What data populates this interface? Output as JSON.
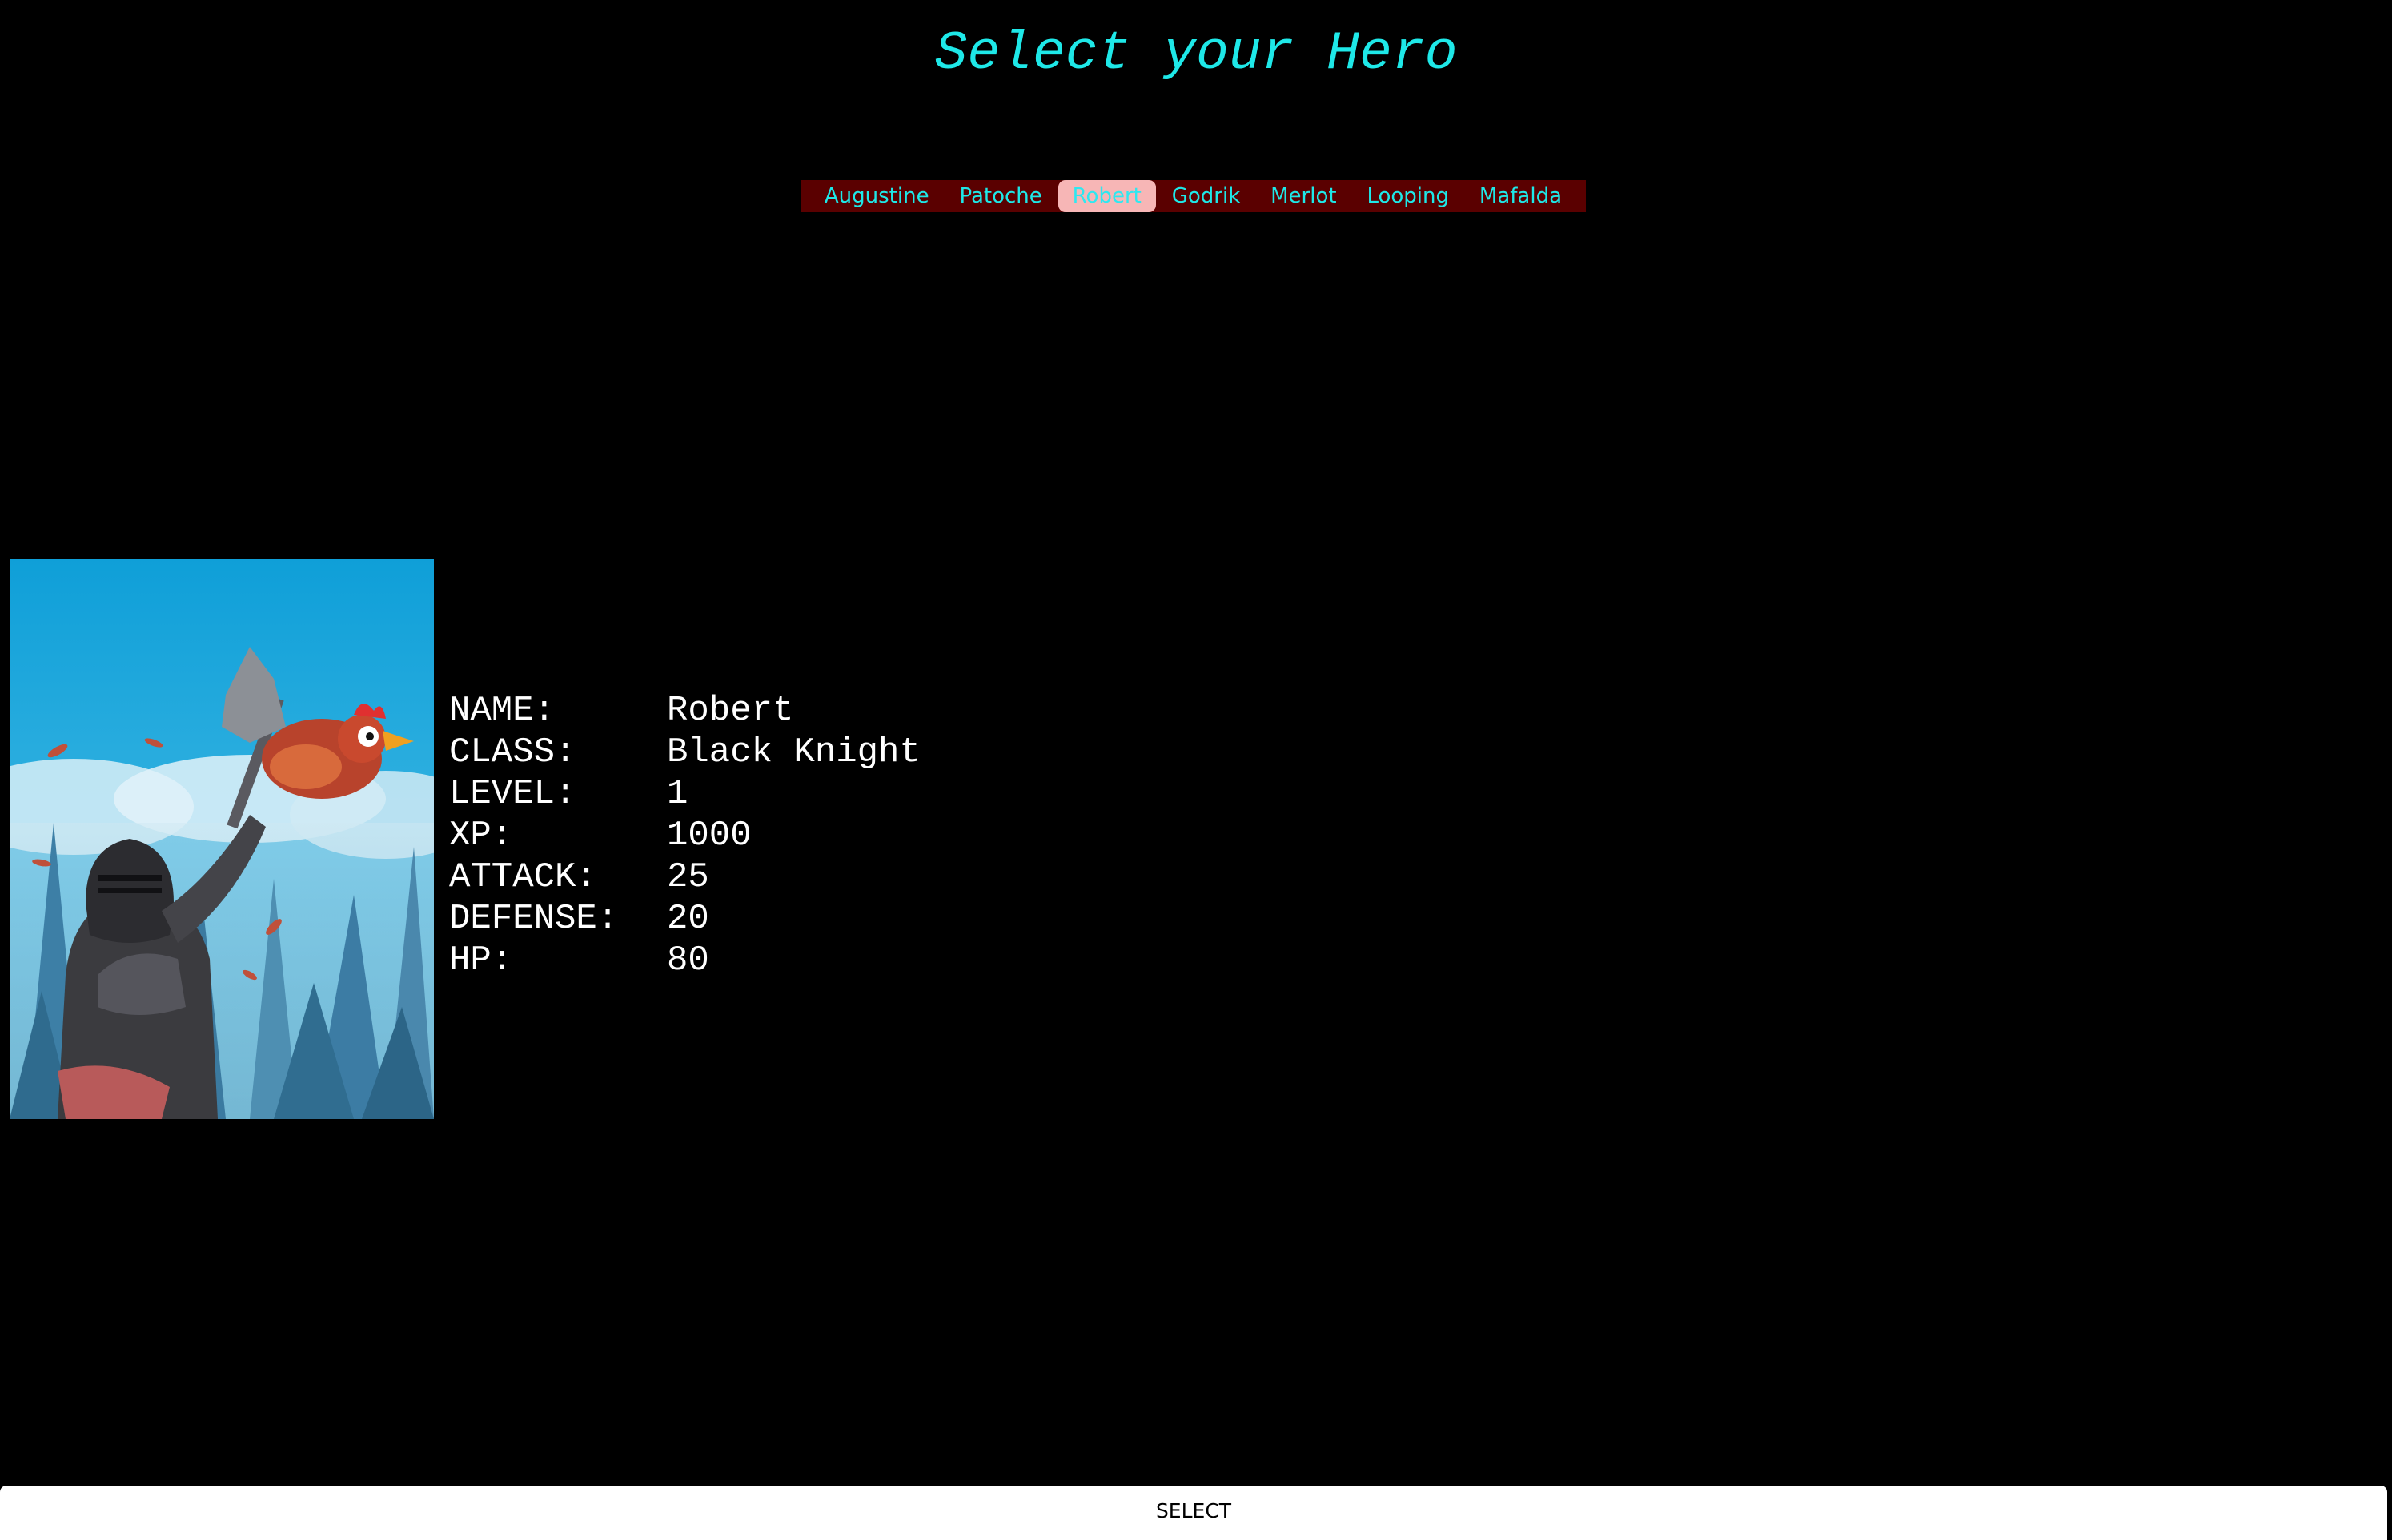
{
  "page": {
    "title": "Select your Hero"
  },
  "tabs": [
    {
      "label": "Augustine",
      "active": false
    },
    {
      "label": "Patoche",
      "active": false
    },
    {
      "label": "Robert",
      "active": true
    },
    {
      "label": "Godrik",
      "active": false
    },
    {
      "label": "Merlot",
      "active": false
    },
    {
      "label": "Looping",
      "active": false
    },
    {
      "label": "Mafalda",
      "active": false
    }
  ],
  "hero": {
    "portrait_icon": "hero-portrait-knight-chicken",
    "stats": [
      {
        "label": "NAME:",
        "value": "Robert"
      },
      {
        "label": "CLASS:",
        "value": "Black Knight"
      },
      {
        "label": "LEVEL:",
        "value": "1"
      },
      {
        "label": "XP:",
        "value": "1000"
      },
      {
        "label": "ATTACK:",
        "value": "25"
      },
      {
        "label": "DEFENSE:",
        "value": "20"
      },
      {
        "label": "HP:",
        "value": "80"
      }
    ]
  },
  "actions": {
    "select_label": "SELECT"
  },
  "colors": {
    "background": "#000000",
    "accent_cyan": "#1ee8e8",
    "tabbar_bg": "#5a0000",
    "active_tab_bg": "#f7b6b6",
    "stat_text": "#ffffff",
    "button_bg": "#ffffff"
  }
}
